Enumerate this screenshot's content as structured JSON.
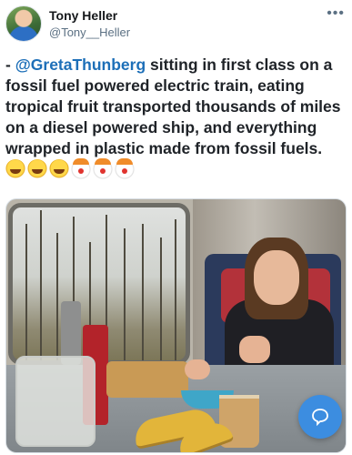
{
  "author": {
    "name": "Tony Heller",
    "handle": "@Tony__Heller"
  },
  "tweet": {
    "prefix": "- ",
    "mention": "@GretaThunberg",
    "body": " sitting in first class on a fossil fuel powered electric train, eating tropical fruit transported thousands of miles on a diesel powered ship, and everything wrapped in plastic made from fossil fuels. "
  },
  "emojis": [
    "rolling-on-floor-laughing",
    "rolling-on-floor-laughing",
    "rolling-on-floor-laughing",
    "clown-face",
    "clown-face",
    "clown-face"
  ],
  "icons": {
    "more": "more-options-icon",
    "reply_fab": "speech-bubble-icon"
  },
  "colors": {
    "mention": "#1d6fb8",
    "fab": "#3c8de0"
  }
}
